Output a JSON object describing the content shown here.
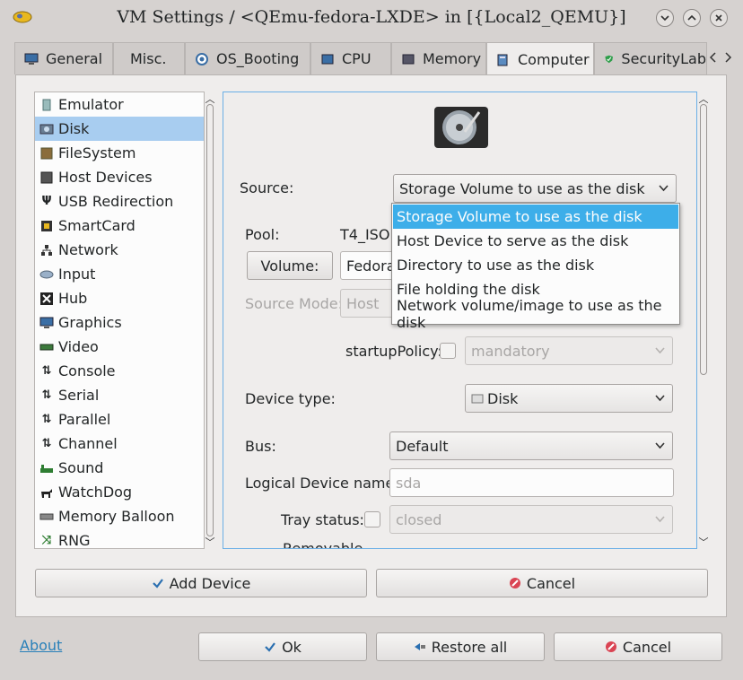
{
  "window": {
    "title": "VM Settings / <QEmu-fedora-LXDE> in [{Local2_QEMU}]"
  },
  "tabs": [
    {
      "label": "General",
      "icon": "monitor-icon"
    },
    {
      "label": "Misc.",
      "icon": ""
    },
    {
      "label": "OS_Booting",
      "icon": "os-booting-icon"
    },
    {
      "label": "CPU",
      "icon": "cpu-icon"
    },
    {
      "label": "Memory",
      "icon": "memory-icon"
    },
    {
      "label": "Computer",
      "icon": "computer-icon",
      "active": true
    },
    {
      "label": "SecurityLab",
      "icon": "shield-icon"
    }
  ],
  "devices": [
    {
      "label": "Emulator",
      "icon": "emulator-icon"
    },
    {
      "label": "Disk",
      "icon": "disk-icon",
      "selected": true
    },
    {
      "label": "FileSystem",
      "icon": "filesystem-icon"
    },
    {
      "label": "Host Devices",
      "icon": "host-devices-icon"
    },
    {
      "label": "USB Redirection",
      "icon": "usb-icon"
    },
    {
      "label": "SmartCard",
      "icon": "smartcard-icon"
    },
    {
      "label": "Network",
      "icon": "network-icon"
    },
    {
      "label": "Input",
      "icon": "input-icon"
    },
    {
      "label": "Hub",
      "icon": "hub-icon"
    },
    {
      "label": "Graphics",
      "icon": "graphics-icon"
    },
    {
      "label": "Video",
      "icon": "video-icon"
    },
    {
      "label": "Console",
      "icon": "console-icon"
    },
    {
      "label": "Serial",
      "icon": "serial-icon"
    },
    {
      "label": "Parallel",
      "icon": "parallel-icon"
    },
    {
      "label": "Channel",
      "icon": "channel-icon"
    },
    {
      "label": "Sound",
      "icon": "sound-icon"
    },
    {
      "label": "WatchDog",
      "icon": "watchdog-icon"
    },
    {
      "label": "Memory Balloon",
      "icon": "memory-balloon-icon"
    },
    {
      "label": "RNG",
      "icon": "rng-icon"
    }
  ],
  "disk": {
    "source_label": "Source:",
    "source_value": "Storage Volume to use as the disk",
    "source_options": [
      "Storage Volume to use as the disk",
      "Host Device to serve as the disk",
      "Directory to use as the disk",
      "File holding the disk",
      "Network volume/image to use as the disk"
    ],
    "pool_label": "Pool:",
    "pool_value": "T4_ISO",
    "volume_button": "Volume:",
    "volume_value": "Fedora",
    "source_mode_label": "Source Mode:",
    "source_mode_value": "Host",
    "startup_policy_label": "startupPolicy:",
    "startup_policy_value": "mandatory",
    "device_type_label": "Device type:",
    "device_type_value": "Disk",
    "bus_label": "Bus:",
    "bus_value": "Default",
    "logical_name_label": "Logical Device name:",
    "logical_name_placeholder": "sda",
    "tray_status_label": "Tray status:",
    "tray_status_value": "closed",
    "removable_label": "Removable"
  },
  "panel_buttons": {
    "add_device": "Add Device",
    "cancel": "Cancel"
  },
  "footer": {
    "about": "About",
    "ok": "Ok",
    "restore_all": "Restore all",
    "cancel": "Cancel"
  },
  "colors": {
    "accent": "#3daee9",
    "selection": "#a8cdf0",
    "link": "#2980b9",
    "cancel_red": "#da4453",
    "check_blue": "#2a6fb0"
  }
}
